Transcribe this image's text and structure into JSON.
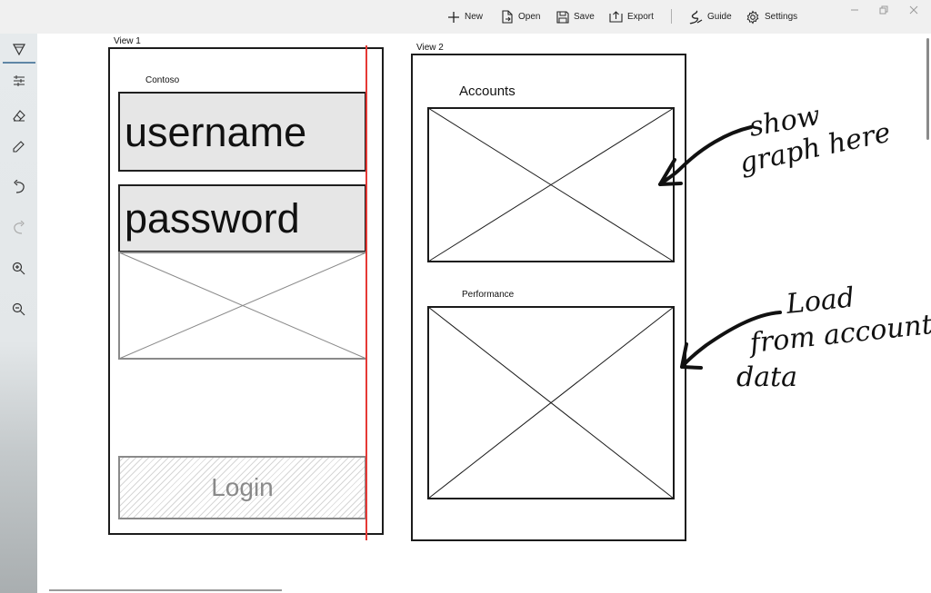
{
  "toolbar": {
    "new_label": "New",
    "open_label": "Open",
    "save_label": "Save",
    "export_label": "Export",
    "guide_label": "Guide",
    "settings_label": "Settings"
  },
  "rail": {
    "tools": [
      "stencil-icon",
      "ruler-settings-icon",
      "eraser-icon",
      "pencil-icon",
      "undo-icon",
      "redo-icon",
      "zoom-in-icon",
      "zoom-out-icon"
    ]
  },
  "canvas": {
    "view1": {
      "label": "View 1",
      "app_name": "Contoso",
      "username": "username",
      "password": "password",
      "login": "Login"
    },
    "view2": {
      "label": "View 2",
      "accounts_label": "Accounts",
      "performance_label": "Performance"
    },
    "annotations": {
      "note1": "show graph here",
      "note2": "Load from account data"
    }
  },
  "colors": {
    "ink": "#111111",
    "guide_line": "#e53935",
    "field_fill": "#e6e6e6",
    "toolbar_bg": "#f0f0f0"
  }
}
